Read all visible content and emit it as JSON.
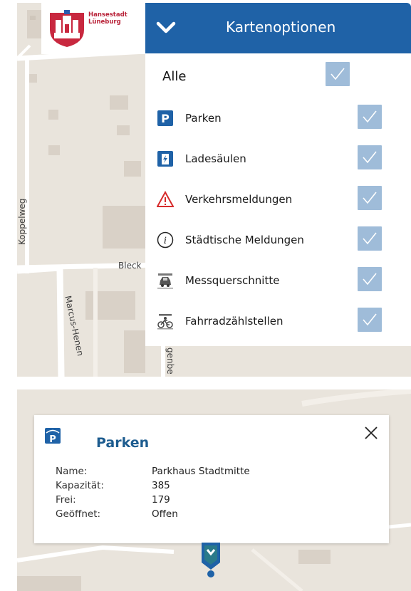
{
  "logo": {
    "line1": "Hansestadt",
    "line2": "Lüneburg"
  },
  "menu": {
    "title": "Kartenoptionen",
    "all_label": "Alle",
    "colors": {
      "header": "#1f62a7",
      "checkbox": "#9fbcd9"
    },
    "items": [
      {
        "label": "Parken",
        "icon": "parking-icon",
        "checked": true
      },
      {
        "label": "Ladesäulen",
        "icon": "charging-station-icon",
        "checked": true
      },
      {
        "label": "Verkehrsmeldungen",
        "icon": "warning-triangle-icon",
        "checked": true
      },
      {
        "label": "Städtische Meldungen",
        "icon": "info-icon",
        "checked": true
      },
      {
        "label": "Messquerschnitte",
        "icon": "traffic-counter-car-icon",
        "checked": true
      },
      {
        "label": "Fahrradzählstellen",
        "icon": "bicycle-counter-icon",
        "checked": true
      }
    ]
  },
  "map_top": {
    "streets": [
      "Koppelweg",
      "Bleck",
      "Marcus-Henen",
      "genbe"
    ]
  },
  "popup": {
    "title": "Parken",
    "icon": "parking-garage-icon",
    "details": [
      {
        "label": "Name:",
        "value": "Parkhaus Stadtmitte"
      },
      {
        "label": "Kapazität:",
        "value": "385"
      },
      {
        "label": "Frei:",
        "value": "179"
      },
      {
        "label": "Geöffnet:",
        "value": "Offen"
      }
    ]
  }
}
